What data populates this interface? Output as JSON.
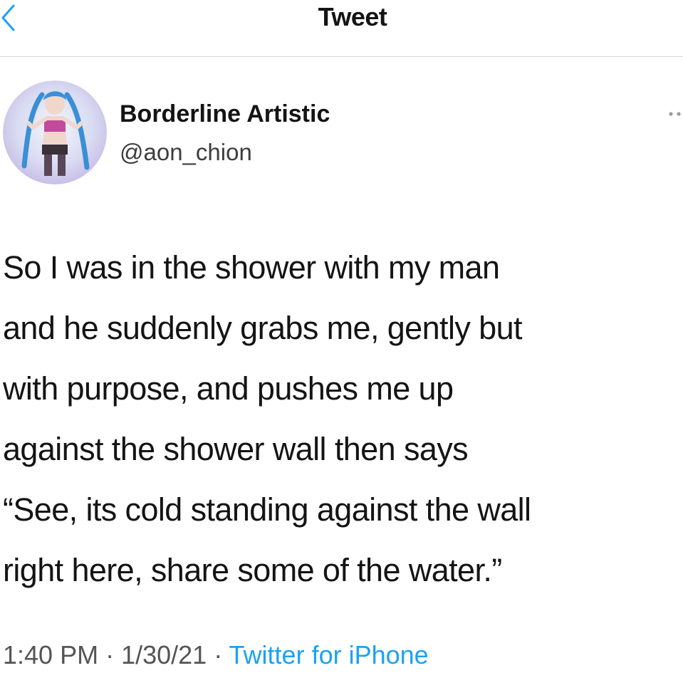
{
  "header": {
    "title": "Tweet",
    "back_icon": "chevron-left-icon"
  },
  "author": {
    "display_name": "Borderline Artistic",
    "handle": "@aon_chion",
    "avatar_icon": "avatar"
  },
  "more_icon": "more-dots-icon",
  "tweet": {
    "lines": [
      "So I was in the shower with my man",
      "and he suddenly grabs me, gently but",
      "with purpose, and pushes me up",
      "against the shower wall then says",
      "“See, its cold standing against the wall",
      "right here, share some of the water.”"
    ]
  },
  "meta": {
    "time": "1:40 PM",
    "separator": " · ",
    "date": "1/30/21",
    "source": "Twitter for iPhone"
  },
  "colors": {
    "accent": "#1da1f2",
    "text": "#141414",
    "secondary_text": "#555555",
    "divider": "#d6d6d6"
  }
}
